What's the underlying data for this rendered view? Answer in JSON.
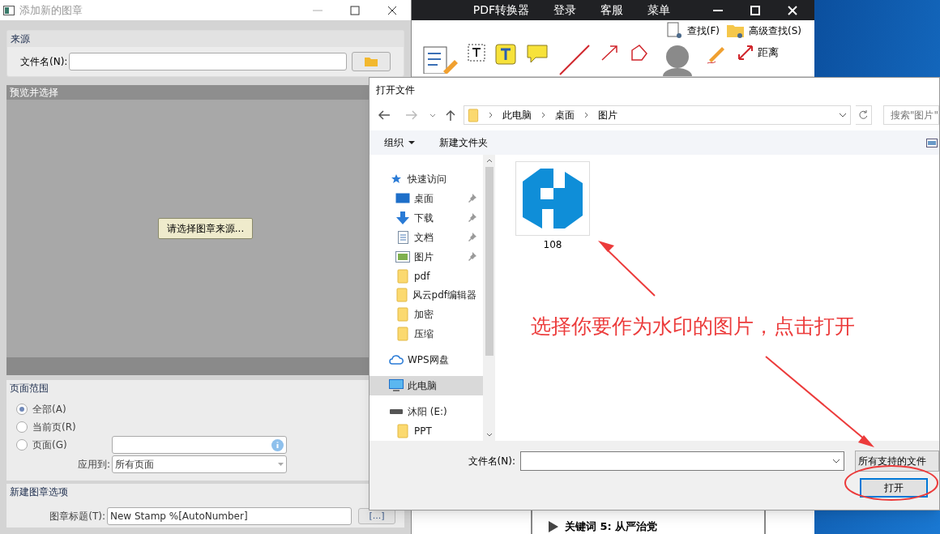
{
  "background_app": {
    "menu": [
      "PDF转换器",
      "登录",
      "客服",
      "菜单"
    ],
    "toolbar": {
      "find": "查找(F)",
      "advanced_find": "高级查找(S)",
      "distance": "距离"
    },
    "content_heading": "关键词 5: 从严治党"
  },
  "stamp_dialog": {
    "title": "添加新的图章",
    "source": {
      "heading": "来源",
      "file_label": "文件名(N):"
    },
    "preview": {
      "heading": "预览并选择",
      "button": "请选择图章来源..."
    },
    "page_range": {
      "heading": "页面范围",
      "options": [
        {
          "label": "全部(A)",
          "selected": true
        },
        {
          "label": "当前页(R)",
          "selected": false
        },
        {
          "label": "页面(G)",
          "selected": false
        }
      ],
      "apply_label": "应用到:",
      "apply_value": "所有页面"
    },
    "new_stamp": {
      "heading": "新建图章选项",
      "title_label": "图章标题(T):",
      "title_value": "New Stamp %[AutoNumber]",
      "macro_button": "[...]"
    }
  },
  "open_dialog": {
    "title": "打开文件",
    "breadcrumb": [
      "此电脑",
      "桌面",
      "图片"
    ],
    "search_placeholder": "搜索\"图片\"",
    "toolbar": {
      "organize": "组织",
      "new_folder": "新建文件夹"
    },
    "nav": [
      {
        "label": "快速访问",
        "kind": "star",
        "selected": false,
        "children": [
          {
            "label": "桌面",
            "kind": "desktop",
            "pinned": true,
            "selected": false
          },
          {
            "label": "下载",
            "kind": "download",
            "pinned": true,
            "selected": false
          },
          {
            "label": "文档",
            "kind": "document",
            "pinned": true,
            "selected": false
          },
          {
            "label": "图片",
            "kind": "picture",
            "pinned": true,
            "selected": false
          },
          {
            "label": "pdf",
            "kind": "folder",
            "pinned": false,
            "selected": false
          },
          {
            "label": "风云pdf编辑器",
            "kind": "folder",
            "pinned": false,
            "selected": false
          },
          {
            "label": "加密",
            "kind": "folder",
            "pinned": false,
            "selected": false
          },
          {
            "label": "压缩",
            "kind": "folder",
            "pinned": false,
            "selected": false
          }
        ]
      },
      {
        "label": "WPS网盘",
        "kind": "cloud",
        "selected": false
      },
      {
        "label": "此电脑",
        "kind": "computer",
        "selected": true
      },
      {
        "label": "沐阳 (E:)",
        "kind": "drive",
        "selected": false,
        "children": [
          {
            "label": "PPT",
            "kind": "folder",
            "pinned": false,
            "selected": false
          }
        ]
      }
    ],
    "files": [
      {
        "name": "108"
      }
    ],
    "annotation": "选择你要作为水印的图片，点击打开",
    "filename_label": "文件名(N):",
    "filter": "所有支持的文件",
    "open_button": "打开"
  }
}
